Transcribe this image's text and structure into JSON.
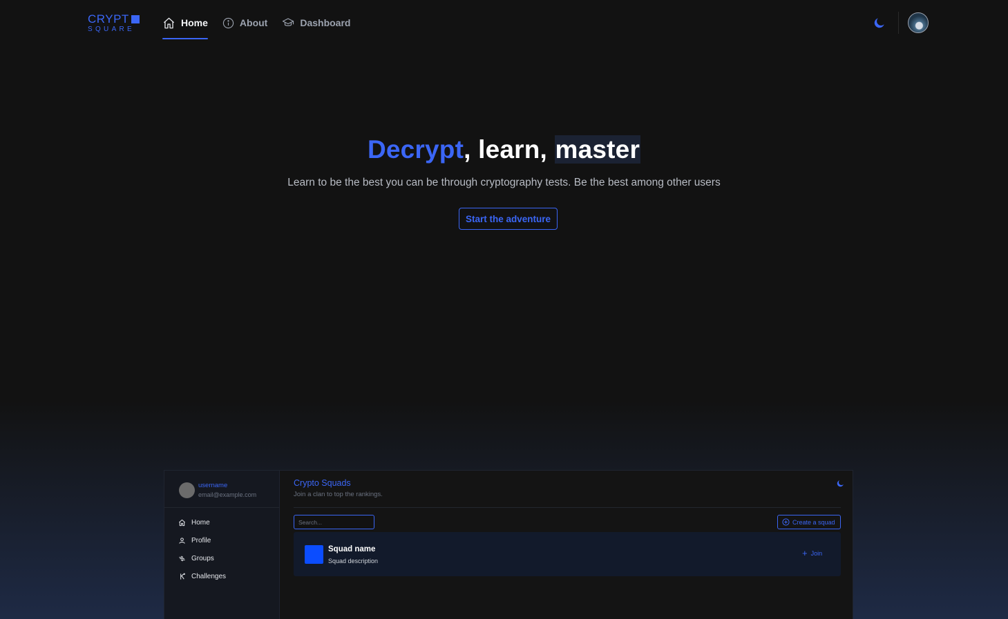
{
  "nav": {
    "logo_top": "CRYPT",
    "logo_bottom": "SQUARE",
    "links": [
      {
        "label": "Home",
        "icon": "home-icon",
        "active": true
      },
      {
        "label": "About",
        "icon": "info-icon",
        "active": false
      },
      {
        "label": "Dashboard",
        "icon": "graduation-cap-icon",
        "active": false
      }
    ],
    "theme_icon": "moon-icon",
    "accent_color": "#3b66f5"
  },
  "hero": {
    "title_word1": "Decrypt",
    "title_sep1": ", ",
    "title_word2": "learn",
    "title_sep2": ", ",
    "title_word3": "master",
    "subtitle": "Learn to be the best you can be through cryptography tests. Be the best among other users",
    "cta_label": "Start the adventure"
  },
  "preview": {
    "username": "username",
    "email": "email@example.com",
    "menu": [
      {
        "label": "Home",
        "icon": "home-icon"
      },
      {
        "label": "Profile",
        "icon": "user-icon"
      },
      {
        "label": "Groups",
        "icon": "groups-icon"
      },
      {
        "label": "Challenges",
        "icon": "challenges-icon"
      }
    ],
    "title": "Crypto Squads",
    "description": "Join a clan to top the rankings.",
    "search_placeholder": "Search...",
    "create_label": "Create a squad",
    "squad": {
      "name": "Squad name",
      "description": "Squad description",
      "join_label": "Join",
      "color": "#0b4dff"
    }
  }
}
